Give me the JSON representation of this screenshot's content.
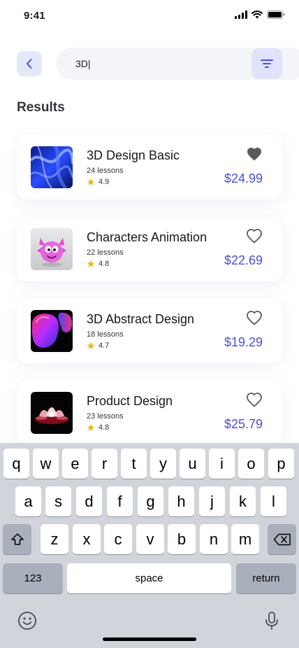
{
  "status_bar": {
    "time": "9:41"
  },
  "search": {
    "value": "3D|",
    "placeholder": ""
  },
  "section_title": "Results",
  "colors": {
    "accent": "#4b4fd8",
    "accent_soft": "#dfe3fb",
    "heart_filled": "#5a5a5e",
    "star": "#f5b400"
  },
  "icons": {
    "back": "chevron-left-icon",
    "filter": "filter-icon",
    "favorite": "heart-icon",
    "rating": "star-icon",
    "emoji": "emoji-icon",
    "mic": "microphone-icon",
    "shift": "shift-icon",
    "delete": "backspace-icon"
  },
  "courses": [
    {
      "title": "3D Design Basic",
      "lessons": "24 lessons",
      "rating": "4.9",
      "price": "$24.99",
      "favorite": true,
      "thumb": "blue-abstract"
    },
    {
      "title": "Characters Animation",
      "lessons": "22 lessons",
      "rating": "4.8",
      "price": "$22.69",
      "favorite": false,
      "thumb": "pink-character"
    },
    {
      "title": "3D Abstract Design",
      "lessons": "18 lessons",
      "rating": "4.7",
      "price": "$19.29",
      "favorite": false,
      "thumb": "gradient-blob"
    },
    {
      "title": "Product Design",
      "lessons": "23 lessons",
      "rating": "4.8",
      "price": "$25.79",
      "favorite": false,
      "thumb": "lotus"
    }
  ],
  "keyboard": {
    "row1": [
      "q",
      "w",
      "e",
      "r",
      "t",
      "y",
      "u",
      "i",
      "o",
      "p"
    ],
    "row2": [
      "a",
      "s",
      "d",
      "f",
      "g",
      "h",
      "j",
      "k",
      "l"
    ],
    "row3": [
      "z",
      "x",
      "c",
      "v",
      "b",
      "n",
      "m"
    ],
    "numbers_label": "123",
    "space_label": "space",
    "return_label": "return"
  }
}
